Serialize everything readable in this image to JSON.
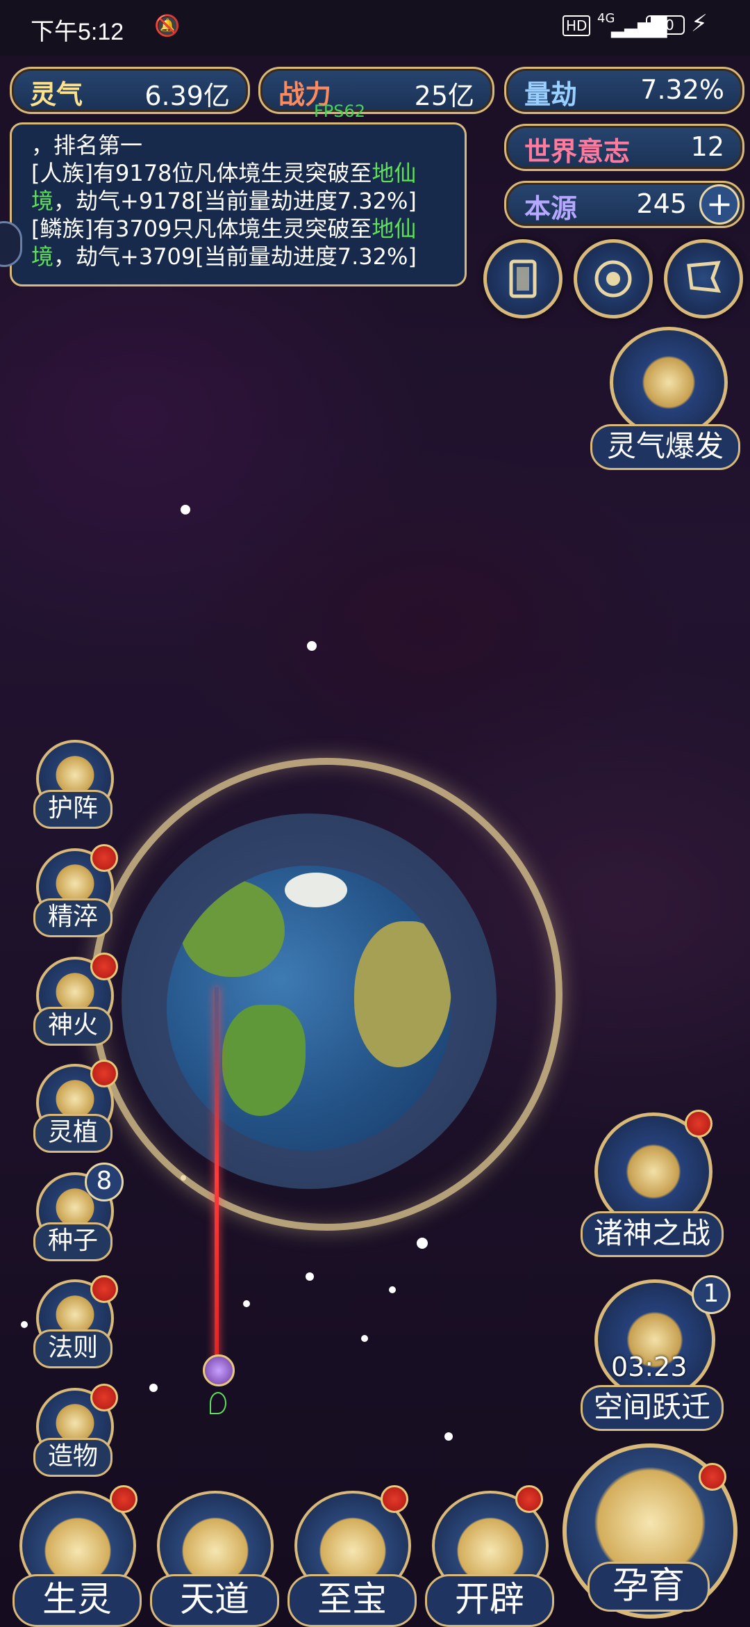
{
  "status_bar": {
    "time": "下午5:12",
    "network": "4G",
    "battery": "30"
  },
  "stats": {
    "lingqi": {
      "label": "灵气",
      "value": "6.39亿"
    },
    "zhanli": {
      "label": "战力",
      "value": "25亿"
    },
    "liangjie": {
      "label": "量劫",
      "value": "7.32%"
    },
    "shijie": {
      "label": "世界意志",
      "value": "12"
    },
    "benyuan": {
      "label": "本源",
      "value": "245"
    },
    "fps": "FPS62"
  },
  "log": {
    "line1": "，排名第一",
    "line2a": "[人族]有9178位凡体境生灵突破至",
    "line2b": "地仙",
    "line3a": "境",
    "line3b": "，劫气+9178[当前量劫进度7.32%]",
    "line4a": "[鳞族]有3709只凡体境生灵突破至",
    "line4b": "地仙",
    "line5a": "境",
    "line5b": "，劫气+3709[当前量劫进度7.32%]"
  },
  "top_icons": [
    "card-icon",
    "portal-icon",
    "banner-icon"
  ],
  "lingqi_burst": {
    "label": "灵气爆发"
  },
  "side_menu": [
    {
      "label": "护阵",
      "icon": "yin-yang-icon",
      "badge": ""
    },
    {
      "label": "精淬",
      "icon": "lotus-icon",
      "badge": "dot"
    },
    {
      "label": "神火",
      "icon": "flame-icon",
      "badge": "dot"
    },
    {
      "label": "灵植",
      "icon": "plant-icon",
      "badge": "dot"
    },
    {
      "label": "种子",
      "icon": "flower-icon",
      "badge": "8"
    },
    {
      "label": "法则",
      "icon": "rune-icon",
      "badge": "dot"
    },
    {
      "label": "造物",
      "icon": "diamond-icon",
      "badge": "dot"
    }
  ],
  "right_panel": {
    "zhushen": {
      "label": "诸神之战"
    },
    "kongjian": {
      "label": "空间跃迁",
      "timer": "03:23",
      "badge": "1"
    }
  },
  "bottom_nav": [
    {
      "label": "生灵"
    },
    {
      "label": "天道"
    },
    {
      "label": "至宝"
    },
    {
      "label": "开辟"
    }
  ],
  "yunyu": {
    "label": "孕育"
  },
  "colors": {
    "gold": "#d8b979",
    "panel": "#1f3460",
    "green_text": "#5fe05a",
    "laser": "#e02424"
  }
}
